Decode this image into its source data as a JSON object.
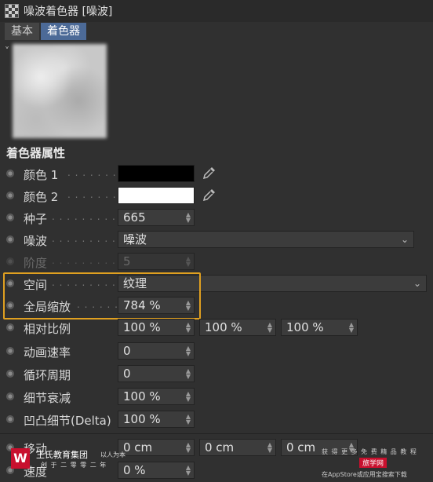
{
  "window": {
    "title": "噪波着色器 [噪波]"
  },
  "tabs": [
    {
      "label": "基本",
      "active": false
    },
    {
      "label": "着色器",
      "active": true
    }
  ],
  "section_title": "着色器属性",
  "fields": {
    "color1": {
      "label": "颜色 1",
      "dots": ". . . . . . . . .",
      "value": "#000000"
    },
    "color2": {
      "label": "颜色 2",
      "dots": ". . . . . . . . .",
      "value": "#ffffff"
    },
    "seed": {
      "label": "种子",
      "dots": ". . . . . . . . . .",
      "value": "665"
    },
    "noise": {
      "label": "噪波",
      "dots": ". . . . . . . . . .",
      "value": "噪波"
    },
    "octaves": {
      "label": "阶度",
      "dots": ". . . . . . . . . .",
      "value": "5"
    },
    "space": {
      "label": "空间",
      "dots": ". . . . . . . . . .",
      "value": "纹理"
    },
    "global_scale": {
      "label": "全局缩放",
      "dots": ". . . . . .",
      "value": "784 %"
    },
    "relative_scale": {
      "label": "相对比例",
      "values": [
        "100 %",
        "100 %",
        "100 %"
      ]
    },
    "animation_speed": {
      "label": "动画速率",
      "value": "0"
    },
    "loop_period": {
      "label": "循环周期",
      "value": "0"
    },
    "detail_attenuation": {
      "label": "细节衰减",
      "value": "100 %"
    },
    "delta": {
      "label": "凹凸细节(Delta)",
      "value": "100 %"
    },
    "movement": {
      "label": "移动",
      "values": [
        "0 cm",
        "0 cm",
        "0 cm"
      ]
    },
    "speed": {
      "label": "速度",
      "value": "0 %"
    }
  },
  "watermark": {
    "brand": "王氏教育集团",
    "slogan": "以人为本",
    "sub": "创 于 二 零 零 二 年",
    "right_top": "获 得 更 多 免 费 精 品 教 程",
    "right_badge": "旅学网",
    "right_bottom": "在AppStore或应用宝搜索下载"
  },
  "colors": {
    "accent_tab": "#4c6a97",
    "highlight": "#e0a020",
    "background": "#303030"
  }
}
